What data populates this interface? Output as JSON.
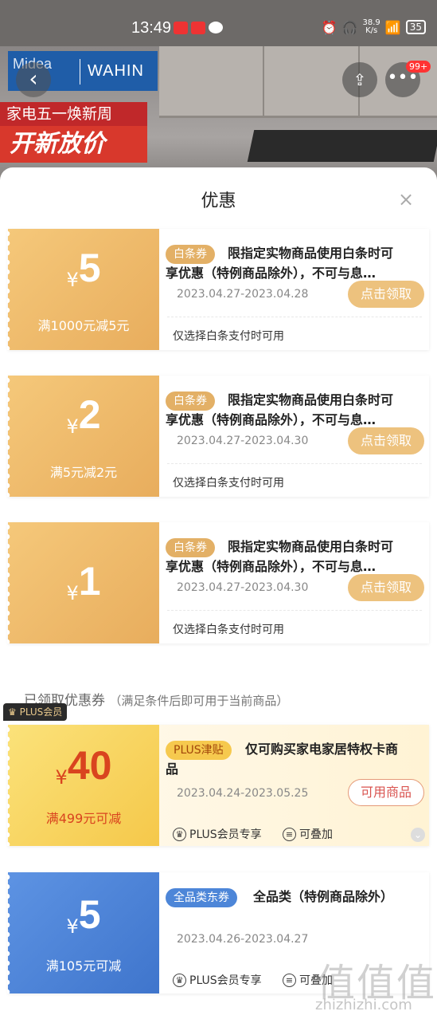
{
  "status_bar": {
    "time": "13:49",
    "speed": "38.9\nK/s",
    "battery": "35"
  },
  "hero": {
    "brand_left": "Midea",
    "brand_right": "WAHIN",
    "promo_line1": "家电五一焕新周",
    "promo_line2": "开新放价",
    "notification_count": "99+"
  },
  "sheet": {
    "title": "优惠",
    "close": "×"
  },
  "coupons": [
    {
      "currency": "¥",
      "amount": "5",
      "condition": "满1000元减5元",
      "tag": "白条券",
      "desc": "限指定实物商品使用白条时可享优惠（特例商品除外），不可与息…",
      "date": "2023.04.27-2023.04.28",
      "button": "点击领取",
      "note": "仅选择白条支付时可用"
    },
    {
      "currency": "¥",
      "amount": "2",
      "condition": "满5元减2元",
      "tag": "白条券",
      "desc": "限指定实物商品使用白条时可享优惠（特例商品除外），不可与息…",
      "date": "2023.04.27-2023.04.30",
      "button": "点击领取",
      "note": "仅选择白条支付时可用"
    },
    {
      "currency": "¥",
      "amount": "1",
      "condition": "",
      "tag": "白条券",
      "desc": "限指定实物商品使用白条时可享优惠（特例商品除外），不可与息…",
      "date": "2023.04.27-2023.04.30",
      "button": "点击领取",
      "note": "仅选择白条支付时可用"
    }
  ],
  "received_section": {
    "label": "已领取优惠券",
    "hint": "（满足条件后即可用于当前商品）"
  },
  "received": [
    {
      "currency": "¥",
      "amount": "40",
      "condition": "满499元可减",
      "tag": "PLUS津贴",
      "desc": "仅可购买家电家居特权卡商品",
      "date": "2023.04.24-2023.05.25",
      "button": "可用商品",
      "features": [
        "PLUS会员专享",
        "可叠加"
      ]
    },
    {
      "ribbon": "PLUS会员",
      "currency": "¥",
      "amount": "5",
      "condition": "满105元可减",
      "tag": "全品类东券",
      "desc": "全品类（特例商品除外）",
      "date": "2023.04.26-2023.04.27",
      "features": [
        "PLUS会员专享",
        "可叠加"
      ]
    }
  ],
  "watermark": {
    "big": "值值值",
    "site": "zhizhizhi.com"
  },
  "colors": {
    "gold": "#e8ad5d",
    "plus_yellow": "#f6d35a",
    "blue": "#4d86d8",
    "red_text": "#d9534f"
  }
}
